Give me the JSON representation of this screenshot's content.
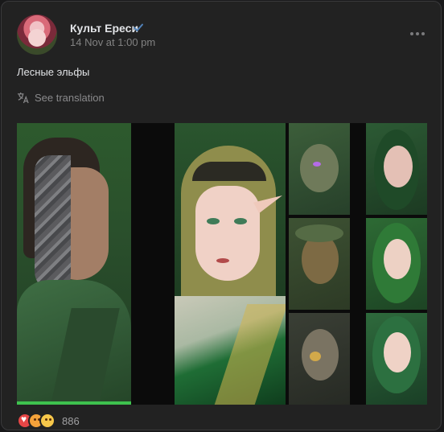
{
  "post": {
    "author": "Культ Ереси",
    "date": "14 Nov at 1:00 pm",
    "text": "Лесные эльфы",
    "translate_label": "See translation",
    "reactions_count": "886"
  },
  "icons": {
    "verified": "verified-check-icon",
    "more": "more-horizontal-icon",
    "translate": "translate-icon",
    "reactions": [
      "heart-reaction-icon",
      "heart-eyes-reaction-icon",
      "surprised-reaction-icon"
    ]
  },
  "colors": {
    "background": "#222222",
    "accent_verified": "#5181b8",
    "text_primary": "#e1e3e6",
    "text_secondary": "#828282"
  }
}
